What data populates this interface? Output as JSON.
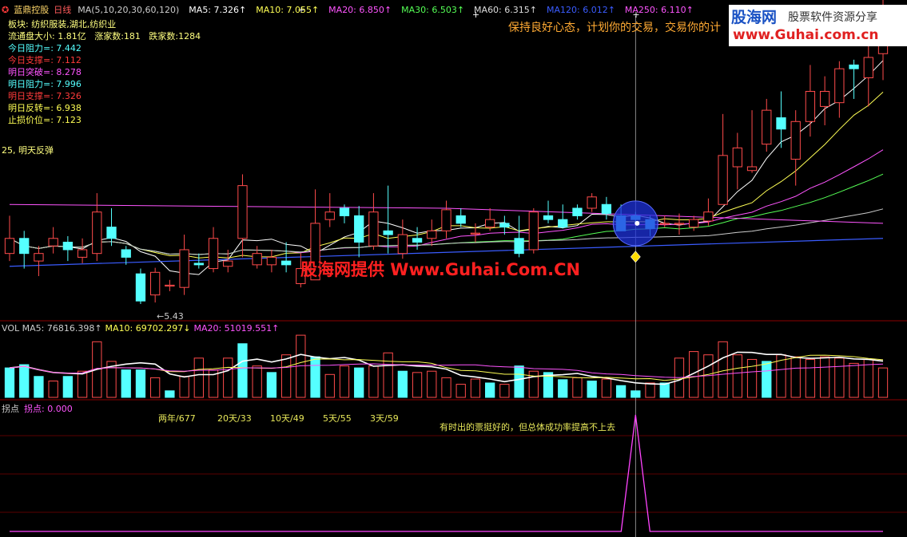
{
  "header": {
    "stock_name": "蓝鼎控股",
    "period": "日线",
    "ma_params": "MA(5,10,20,30,60,120)",
    "ma_values": [
      {
        "text": "MA5: 7.326↑",
        "color": "#ffffff"
      },
      {
        "text": "MA10: 7.055↑",
        "color": "#ffff55"
      },
      {
        "text": "MA20: 6.850↑",
        "color": "#ff55ff"
      },
      {
        "text": "MA30: 6.503↑",
        "color": "#55ff55"
      },
      {
        "text": "MA60: 6.315↑",
        "color": "#dddddd"
      },
      {
        "text": "MA120: 6.012↑",
        "color": "#3a5cff"
      },
      {
        "text": "MA250: 6.110↑",
        "color": "#ff55ff"
      }
    ]
  },
  "info": {
    "sector": "板块: 纺织服装,湖北,纺织业",
    "float_cap": "流通盘大小: 1.81亿",
    "up_count": "涨家数:181",
    "down_count": "跌家数:1284",
    "lines": [
      {
        "text": "今日阻力=: 7.442",
        "color": "#55ffff"
      },
      {
        "text": "今日支撑=: 7.112",
        "color": "#ff3b3b"
      },
      {
        "text": "明日突破=: 8.278",
        "color": "#ff55ff"
      },
      {
        "text": "明日阻力=: 7.996",
        "color": "#55ffff"
      },
      {
        "text": "明日支撑=: 7.326",
        "color": "#ff3b3b"
      },
      {
        "text": "明日反转=: 6.938",
        "color": "#ffff55"
      },
      {
        "text": "止损价位=: 7.123",
        "color": "#ffff55"
      }
    ],
    "signal_text": "25, 明天反弹"
  },
  "banner": {
    "motto": "保持良好心态，计划你的交易，交易你的计",
    "logo_cn": "股海网",
    "logo_sub": "股票软件资源分享",
    "logo_url": "www.Guhai.com.cn",
    "watermark": "股海网提供 Www.Guhai.Com.CN"
  },
  "low_label": "←5.43",
  "volume_header": {
    "vol_ma5": "VOL MA5: 76816.398↑",
    "vol_ma10": "MA10: 69702.297↓",
    "vol_ma20": "MA20: 51019.551↑"
  },
  "indicator": {
    "title": "拐点",
    "value": "拐点: 0.000",
    "stats": [
      "两年/677",
      "20天/33",
      "10天/49",
      "5天/55",
      "3天/59"
    ],
    "note": "有时出的票挺好的，但总体成功率提高不上去"
  },
  "colors": {
    "up": "#ff4b4b",
    "down": "#55ffff",
    "grid": "#8b0000"
  },
  "chart_data": {
    "type": "candlestick",
    "price_ylim": [
      5.2,
      9.2
    ],
    "candles": [
      [
        6.05,
        6.25,
        6.55,
        5.95
      ],
      [
        6.25,
        6.05,
        6.35,
        5.85
      ],
      [
        5.95,
        6.05,
        6.15,
        5.75
      ],
      [
        6.15,
        6.25,
        6.4,
        6.05
      ],
      [
        6.2,
        6.1,
        6.28,
        5.95
      ],
      [
        6.0,
        6.1,
        6.25,
        5.92
      ],
      [
        6.05,
        6.6,
        6.85,
        5.95
      ],
      [
        6.4,
        6.25,
        6.65,
        6.15
      ],
      [
        6.1,
        6.0,
        6.15,
        5.9
      ],
      [
        5.78,
        5.42,
        5.85,
        5.38
      ],
      [
        5.5,
        5.8,
        5.86,
        5.4
      ],
      [
        5.62,
        5.63,
        5.7,
        5.55
      ],
      [
        5.6,
        6.1,
        6.3,
        5.5
      ],
      [
        5.92,
        5.9,
        6.05,
        5.85
      ],
      [
        5.85,
        6.25,
        6.4,
        5.8
      ],
      [
        5.88,
        5.95,
        6.1,
        5.8
      ],
      [
        6.25,
        6.95,
        7.1,
        6.0
      ],
      [
        5.9,
        6.05,
        6.15,
        5.85
      ],
      [
        5.9,
        6.0,
        6.1,
        5.8
      ],
      [
        5.95,
        5.9,
        6.2,
        5.8
      ],
      [
        5.65,
        5.85,
        6.05,
        5.6
      ],
      [
        5.7,
        6.45,
        6.9,
        5.7
      ],
      [
        6.5,
        6.6,
        6.85,
        6.4
      ],
      [
        6.65,
        6.55,
        6.7,
        6.45
      ],
      [
        6.55,
        6.2,
        6.68,
        6.0
      ],
      [
        6.15,
        6.6,
        6.85,
        6.1
      ],
      [
        6.35,
        6.3,
        6.95,
        6.05
      ],
      [
        6.05,
        6.3,
        6.5,
        5.98
      ],
      [
        6.25,
        6.2,
        6.4,
        6.1
      ],
      [
        6.25,
        6.35,
        6.5,
        6.15
      ],
      [
        6.35,
        6.63,
        6.75,
        6.25
      ],
      [
        6.55,
        6.45,
        6.65,
        6.4
      ],
      [
        6.32,
        6.32,
        6.45,
        6.2
      ],
      [
        6.4,
        6.5,
        6.65,
        6.35
      ],
      [
        6.45,
        6.4,
        6.55,
        6.3
      ],
      [
        6.25,
        6.05,
        6.55,
        6.0
      ],
      [
        6.1,
        6.6,
        6.65,
        6.05
      ],
      [
        6.55,
        6.5,
        6.75,
        6.45
      ],
      [
        6.5,
        6.4,
        6.7,
        6.38
      ],
      [
        6.65,
        6.55,
        6.7,
        6.5
      ],
      [
        6.65,
        6.8,
        6.85,
        6.6
      ],
      [
        6.7,
        6.58,
        6.8,
        6.5
      ],
      [
        6.55,
        6.35,
        6.7,
        6.35
      ],
      [
        6.55,
        6.5,
        6.6,
        6.45
      ],
      [
        6.5,
        6.38,
        6.55,
        6.28
      ],
      [
        6.45,
        6.45,
        6.55,
        6.4
      ],
      [
        6.45,
        6.45,
        6.58,
        6.3
      ],
      [
        6.4,
        6.5,
        6.55,
        6.35
      ],
      [
        6.48,
        6.6,
        6.78,
        6.42
      ],
      [
        6.7,
        7.35,
        7.9,
        6.75
      ],
      [
        7.2,
        7.45,
        7.65,
        6.9
      ],
      [
        7.15,
        7.2,
        7.95,
        7.12
      ],
      [
        7.5,
        7.95,
        8.1,
        7.4
      ],
      [
        7.85,
        7.7,
        8.2,
        7.45
      ],
      [
        7.3,
        7.8,
        7.95,
        6.95
      ],
      [
        7.8,
        8.2,
        8.55,
        7.6
      ],
      [
        8.0,
        8.2,
        8.4,
        7.75
      ],
      [
        8.05,
        8.5,
        8.6,
        7.85
      ],
      [
        8.55,
        8.5,
        8.62,
        8.1
      ],
      [
        8.38,
        8.65,
        8.95,
        8.0
      ],
      [
        8.7,
        9.2,
        9.5,
        8.35
      ]
    ],
    "volume_ylim": [
      0,
      100
    ],
    "volume": [
      [
        45,
        "d"
      ],
      [
        50,
        "d"
      ],
      [
        32,
        "d"
      ],
      [
        25,
        "u"
      ],
      [
        32,
        "d"
      ],
      [
        40,
        "u"
      ],
      [
        85,
        "u"
      ],
      [
        55,
        "u"
      ],
      [
        42,
        "d"
      ],
      [
        42,
        "d"
      ],
      [
        30,
        "u"
      ],
      [
        10,
        "d"
      ],
      [
        32,
        "u"
      ],
      [
        60,
        "u"
      ],
      [
        42,
        "u"
      ],
      [
        60,
        "u"
      ],
      [
        82,
        "d"
      ],
      [
        48,
        "u"
      ],
      [
        38,
        "d"
      ],
      [
        65,
        "u"
      ],
      [
        95,
        "u"
      ],
      [
        62,
        "d"
      ],
      [
        35,
        "u"
      ],
      [
        48,
        "u"
      ],
      [
        45,
        "d"
      ],
      [
        48,
        "u"
      ],
      [
        68,
        "u"
      ],
      [
        40,
        "d"
      ],
      [
        38,
        "u"
      ],
      [
        40,
        "u"
      ],
      [
        30,
        "u"
      ],
      [
        20,
        "u"
      ],
      [
        28,
        "u"
      ],
      [
        22,
        "d"
      ],
      [
        20,
        "u"
      ],
      [
        48,
        "d"
      ],
      [
        40,
        "u"
      ],
      [
        38,
        "d"
      ],
      [
        27,
        "d"
      ],
      [
        30,
        "u"
      ],
      [
        25,
        "d"
      ],
      [
        28,
        "u"
      ],
      [
        18,
        "d"
      ],
      [
        10,
        "d"
      ],
      [
        22,
        "u"
      ],
      [
        22,
        "d"
      ],
      [
        60,
        "u"
      ],
      [
        70,
        "u"
      ],
      [
        65,
        "u"
      ],
      [
        85,
        "u"
      ],
      [
        65,
        "u"
      ],
      [
        58,
        "u"
      ],
      [
        55,
        "d"
      ],
      [
        65,
        "u"
      ],
      [
        62,
        "u"
      ],
      [
        58,
        "u"
      ],
      [
        62,
        "u"
      ],
      [
        60,
        "u"
      ],
      [
        52,
        "u"
      ],
      [
        58,
        "u"
      ],
      [
        45,
        "u"
      ]
    ]
  }
}
